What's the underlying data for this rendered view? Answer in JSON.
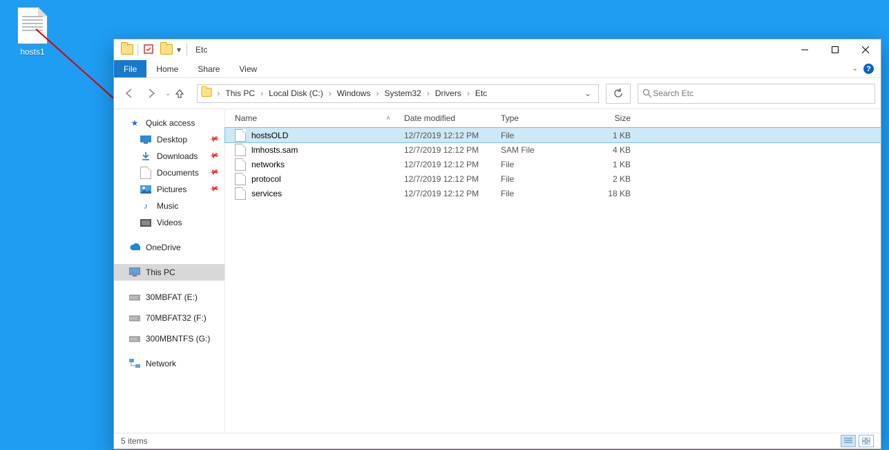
{
  "desktop": {
    "file_label": "hosts1"
  },
  "window": {
    "title": "Etc",
    "tabs": {
      "file": "File",
      "home": "Home",
      "share": "Share",
      "view": "View"
    }
  },
  "breadcrumb": {
    "items": [
      "This PC",
      "Local Disk (C:)",
      "Windows",
      "System32",
      "Drivers",
      "Etc"
    ]
  },
  "search": {
    "placeholder": "Search Etc"
  },
  "navpane": {
    "quick_access": "Quick access",
    "desktop": "Desktop",
    "downloads": "Downloads",
    "documents": "Documents",
    "pictures": "Pictures",
    "music": "Music",
    "videos": "Videos",
    "onedrive": "OneDrive",
    "this_pc": "This PC",
    "drive_e": "30MBFAT (E:)",
    "drive_f": "70MBFAT32 (F:)",
    "drive_g": "300MBNTFS (G:)",
    "network": "Network"
  },
  "columns": {
    "name": "Name",
    "date": "Date modified",
    "type": "Type",
    "size": "Size"
  },
  "files": [
    {
      "name": "hostsOLD",
      "date": "12/7/2019 12:12 PM",
      "type": "File",
      "size": "1 KB",
      "selected": true
    },
    {
      "name": "lmhosts.sam",
      "date": "12/7/2019 12:12 PM",
      "type": "SAM File",
      "size": "4 KB",
      "selected": false
    },
    {
      "name": "networks",
      "date": "12/7/2019 12:12 PM",
      "type": "File",
      "size": "1 KB",
      "selected": false
    },
    {
      "name": "protocol",
      "date": "12/7/2019 12:12 PM",
      "type": "File",
      "size": "2 KB",
      "selected": false
    },
    {
      "name": "services",
      "date": "12/7/2019 12:12 PM",
      "type": "File",
      "size": "18 KB",
      "selected": false
    }
  ],
  "status": {
    "count": "5 items"
  }
}
